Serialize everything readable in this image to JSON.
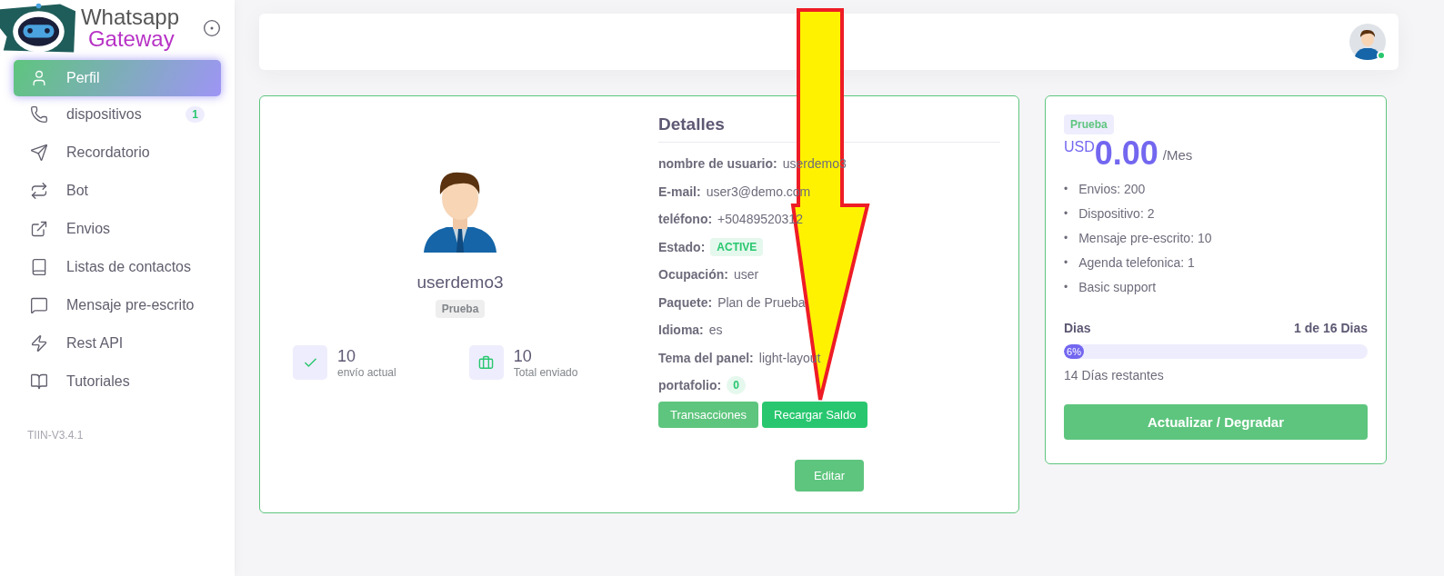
{
  "brand": {
    "line1": "Whatsapp",
    "line2": "Gateway"
  },
  "sidebar": {
    "items": [
      {
        "label": "Perfil",
        "selected": true
      },
      {
        "label": "dispositivos",
        "selected": false,
        "badge": "1"
      },
      {
        "label": "Recordatorio",
        "selected": false
      },
      {
        "label": "Bot",
        "selected": false
      },
      {
        "label": "Envios",
        "selected": false
      },
      {
        "label": "Listas de contactos",
        "selected": false
      },
      {
        "label": "Mensaje pre-escrito",
        "selected": false
      },
      {
        "label": "Rest API",
        "selected": false
      },
      {
        "label": "Tutoriales",
        "selected": false
      }
    ],
    "version": "TIIN-V3.4.1"
  },
  "header": {
    "online": true
  },
  "profile": {
    "username": "userdemo3",
    "plan_badge": "Prueba",
    "stats": [
      {
        "value": "10",
        "label": "envío actual"
      },
      {
        "value": "10",
        "label": "Total enviado"
      }
    ],
    "details_title": "Detalles",
    "details": [
      {
        "label": "nombre de usuario:",
        "value": "userdemo3",
        "kind": "text"
      },
      {
        "label": "E-mail:",
        "value": "user3@demo.com",
        "kind": "text"
      },
      {
        "label": "teléfono:",
        "value": "+50489520312",
        "kind": "text"
      },
      {
        "label": "Estado:",
        "value": "ACTIVE",
        "kind": "badge"
      },
      {
        "label": "Ocupación:",
        "value": "user",
        "kind": "text"
      },
      {
        "label": "Paquete:",
        "value": "Plan de Prueba",
        "kind": "text"
      },
      {
        "label": "Idioma:",
        "value": "es",
        "kind": "text"
      },
      {
        "label": "Tema del panel:",
        "value": "light-layout",
        "kind": "text"
      },
      {
        "label": "portafolio:",
        "value": "0",
        "kind": "badge"
      }
    ],
    "buttons": [
      {
        "label": "Transacciones",
        "kind": "light"
      },
      {
        "label": "Recargar Saldo",
        "kind": "solid"
      }
    ],
    "edit_button": "Editar"
  },
  "plan": {
    "badge": "Prueba",
    "currency": "USD",
    "price": "0.00",
    "period": "/Mes",
    "features": [
      {
        "marker": "•",
        "text": "Envios: 200"
      },
      {
        "marker": "•",
        "text": "Dispositivo: 2"
      },
      {
        "marker": "•",
        "text": "Mensaje pre-escrito: 10"
      },
      {
        "marker": "•",
        "text": "Agenda telefonica: 1"
      },
      {
        "marker": "•",
        "text": "Basic support"
      }
    ],
    "days_label": "Dias",
    "days_value": "1 de 16 Dias",
    "level": 0.06,
    "percent": "6%",
    "remaining": "14 Días restantes",
    "button": "Actualizar / Degradar"
  },
  "annotation": {
    "kind": "arrow"
  }
}
